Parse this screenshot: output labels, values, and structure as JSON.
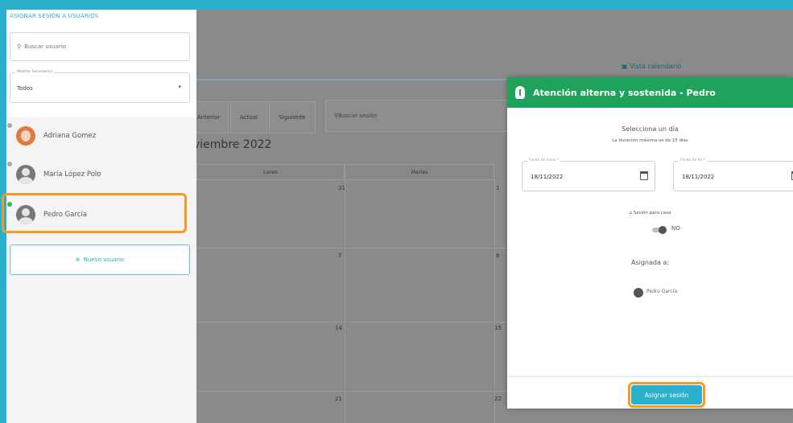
{
  "background": {
    "tab_label": "Vista calendario",
    "toolbar": {
      "prev_label": "Anterior",
      "today_label": "Actual",
      "next_label": "Siguiente",
      "search_placeholder": "Buscar sesión"
    },
    "month_title": "viembre 2022",
    "weekday_headers": [
      "Lunes",
      "Martes"
    ],
    "day_numbers": [
      "31",
      "1",
      "7",
      "8",
      "14",
      "15",
      "21",
      "22"
    ]
  },
  "left_panel": {
    "header": "ASIGNAR SESIÓN A USUARIOS",
    "search_placeholder": "Buscar usuario",
    "filter_label": "Mostrar Sesiones(s)",
    "filter_value": "Todos",
    "users": [
      {
        "name": "Adriana Gomez",
        "avatar": "photo"
      },
      {
        "name": "María López Polo",
        "avatar": "default"
      },
      {
        "name": "Pedro García",
        "avatar": "default",
        "selected": true
      }
    ],
    "new_user_label": "Nuevo usuario"
  },
  "dialog": {
    "title": "Atención alterna y sostenida - Pedro",
    "header_color": "#1fa35a",
    "select_day_title": "Selecciona un día",
    "select_day_note": "La duración máxima es de 15 días",
    "start_date": {
      "label": "Fecha de inicio *",
      "value": "18/11/2022"
    },
    "end_date": {
      "label": "Fecha de fin *",
      "value": "18/11/2022"
    },
    "home_session_label": "Sesión para casa",
    "home_session_toggle": "NO",
    "assigned_title": "Asignada a:",
    "assigned_user": "Pedro García",
    "assign_button": "Asignar sesión"
  },
  "colors": {
    "accent": "#2ab0cc",
    "highlight": "#f59a23",
    "success": "#3cba54"
  }
}
